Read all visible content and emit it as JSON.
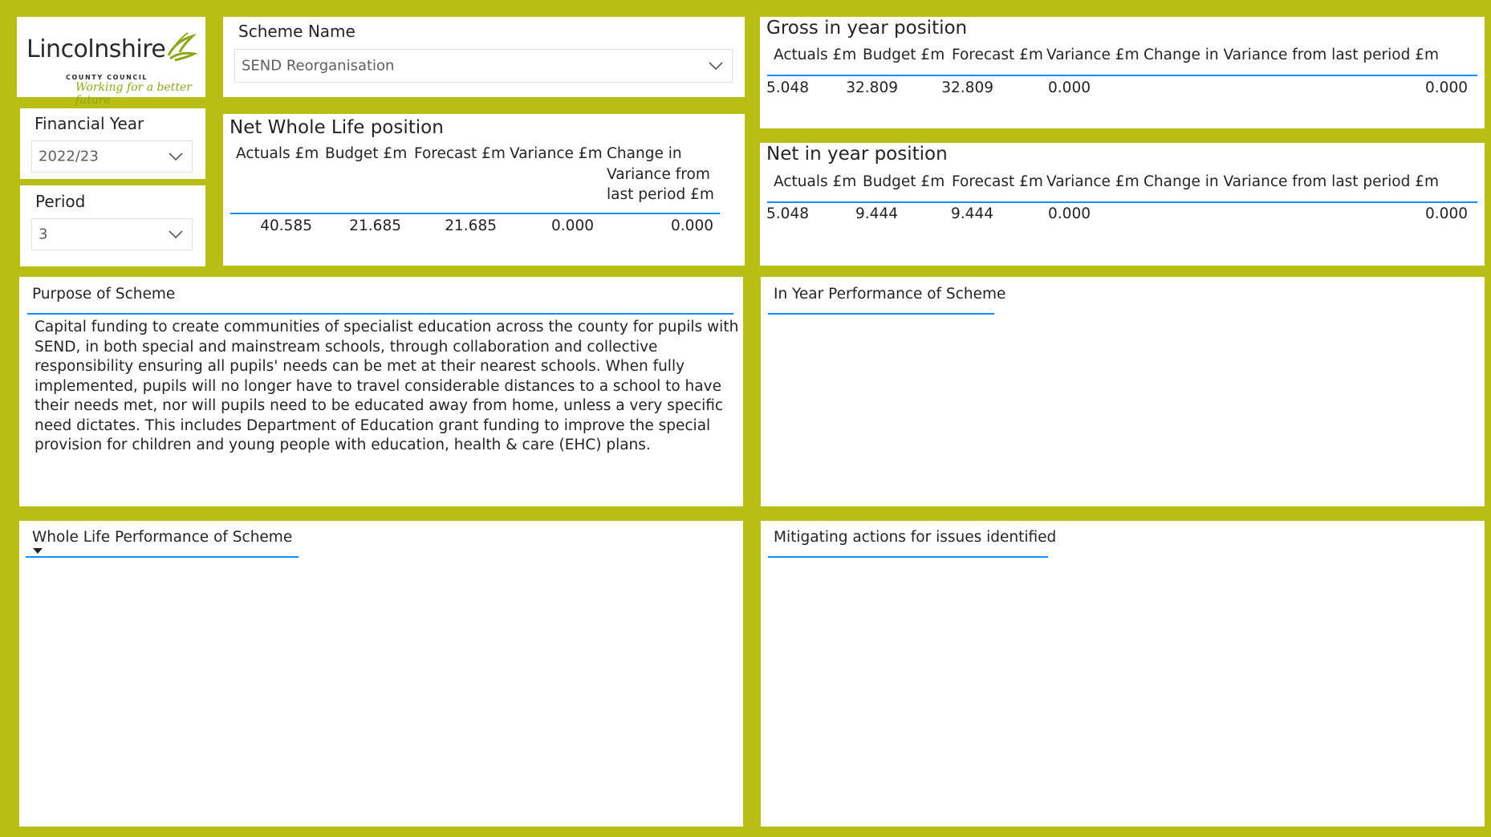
{
  "logo": {
    "name": "Lincolnshire",
    "sub": "COUNTY COUNCIL",
    "tagline": "Working for a better future"
  },
  "scheme_slicer": {
    "title": "Scheme Name",
    "value": "SEND Reorganisation"
  },
  "fy_slicer": {
    "title": "Financial Year",
    "value": "2022/23"
  },
  "period_slicer": {
    "title": "Period",
    "value": "3"
  },
  "net_whole_life": {
    "title": "Net Whole Life position",
    "headers": [
      "Actuals £m",
      "Budget £m",
      "Forecast £m",
      "Variance £m",
      "Change in",
      "Variance from",
      "last period £m"
    ],
    "values": [
      "40.585",
      "21.685",
      "21.685",
      "0.000",
      "0.000"
    ]
  },
  "gross_in_year": {
    "title": "Gross in year position",
    "headers": [
      "Actuals £m",
      "Budget £m",
      "Forecast £m",
      "Variance £m",
      "Change in Variance from last period £m"
    ],
    "values": [
      "5.048",
      "32.809",
      "32.809",
      "0.000",
      "0.000"
    ]
  },
  "net_in_year": {
    "title": "Net in year position",
    "headers": [
      "Actuals £m",
      "Budget £m",
      "Forecast £m",
      "Variance £m",
      "Change in Variance from last period £m"
    ],
    "values": [
      "5.048",
      "9.444",
      "9.444",
      "0.000",
      "0.000"
    ]
  },
  "purpose": {
    "title": "Purpose of Scheme",
    "text": "Capital funding to create communities of specialist education across the county for pupils with SEND, in both special and mainstream schools, through collaboration and collective responsibility ensuring all pupils' needs can be met at their nearest schools. When fully implemented, pupils will no longer have to travel considerable distances to a school to have their needs met, nor will pupils need to be educated away from home, unless a very specific need dictates. This includes Department of Education grant funding to improve the special provision for children and young people with education, health & care (EHC) plans."
  },
  "in_year_performance": {
    "title": "In Year Performance of Scheme"
  },
  "whole_life_performance": {
    "title": "Whole Life Performance of Scheme"
  },
  "mitigating_actions": {
    "title": "Mitigating actions for issues identified"
  },
  "colors": {
    "background": "#b8be14",
    "accent_rule": "#118dff",
    "logo_green": "#8fa61a"
  }
}
